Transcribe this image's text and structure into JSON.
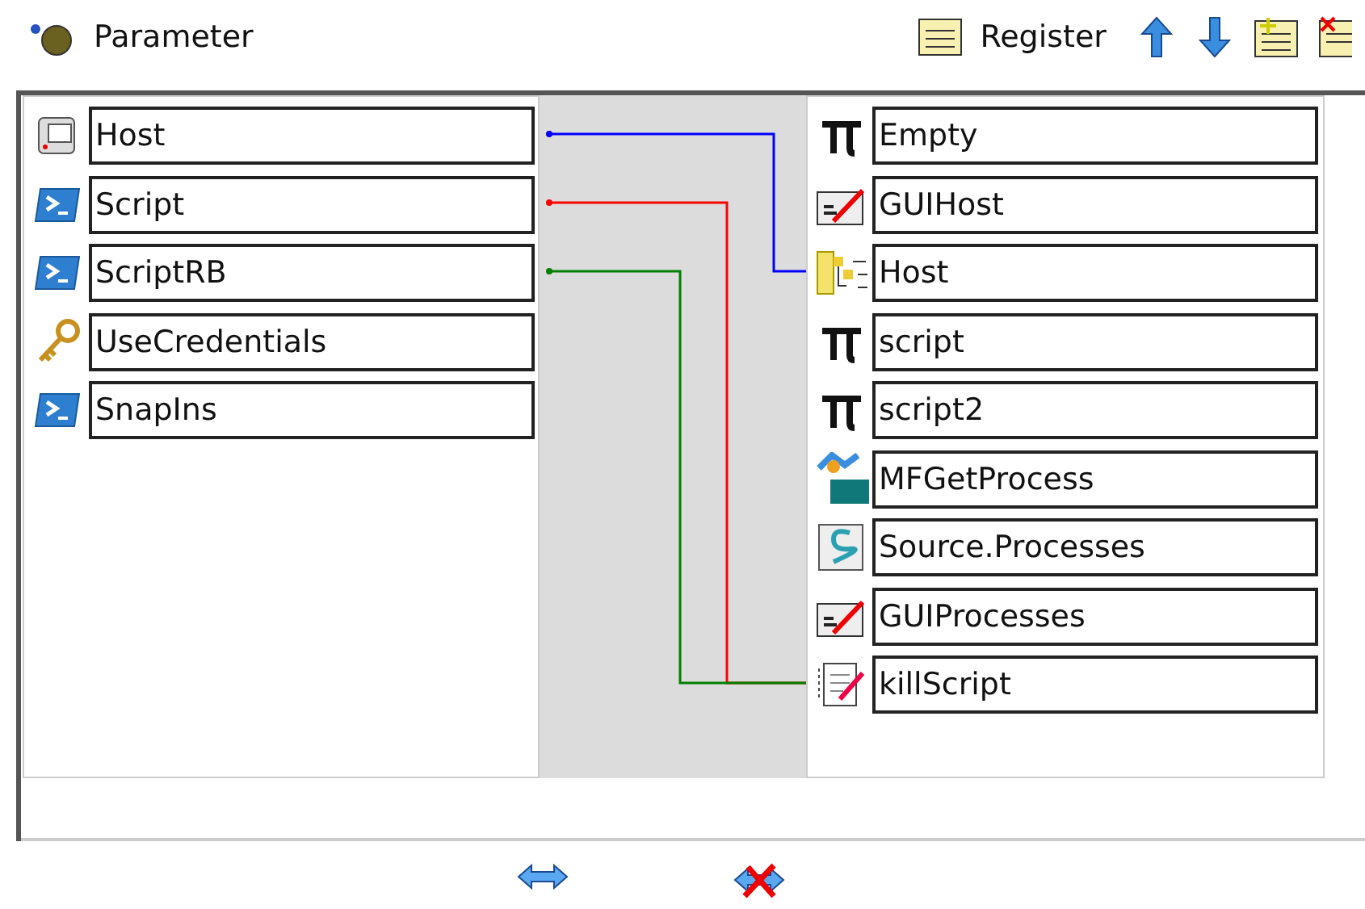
{
  "header": {
    "title": "Parameter",
    "register_label": "Register"
  },
  "inputs": [
    {
      "label": "Host",
      "kind": "host",
      "color": "#0000ff"
    },
    {
      "label": "Script",
      "kind": "shell",
      "color": "#ff0000"
    },
    {
      "label": "ScriptRB",
      "kind": "shell",
      "color": "#008000"
    },
    {
      "label": "UseCredentials",
      "kind": "key"
    },
    {
      "label": "SnapIns",
      "kind": "shell"
    }
  ],
  "outputs": [
    {
      "label": "Empty",
      "kind": "pi"
    },
    {
      "label": "GUIHost",
      "kind": "edit"
    },
    {
      "label": "Host",
      "kind": "tree",
      "linked": true
    },
    {
      "label": "script",
      "kind": "pi"
    },
    {
      "label": "script2",
      "kind": "pi"
    },
    {
      "label": "MFGetProcess",
      "kind": "om"
    },
    {
      "label": "Source.Processes",
      "kind": "source"
    },
    {
      "label": "GUIProcesses",
      "kind": "edit"
    },
    {
      "label": "killScript",
      "kind": "note",
      "linked": true
    }
  ]
}
